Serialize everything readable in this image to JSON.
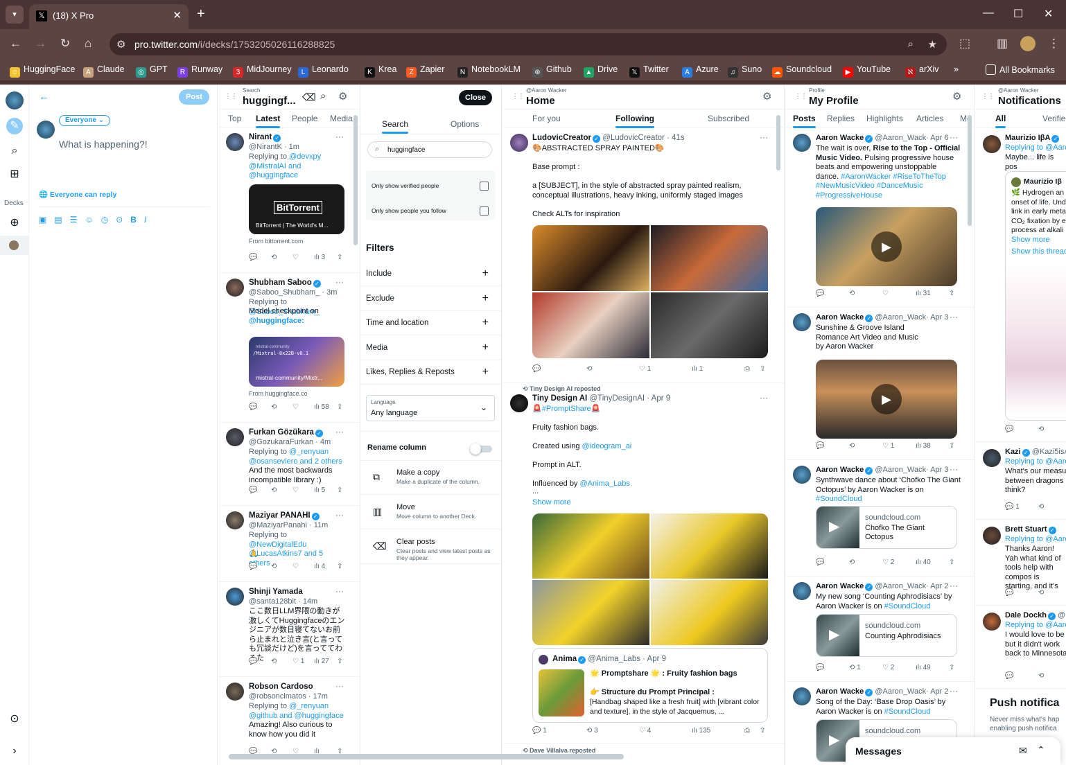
{
  "browser": {
    "tab_title": "(18) X Pro",
    "url_host": "pro.twitter.com",
    "url_path": "/i/decks/1753205026116288825",
    "bookmarks": [
      "HuggingFace",
      "Claude",
      "GPT",
      "Runway",
      "MidJourney",
      "Leonardo",
      "Krea",
      "Zapier",
      "NotebookLM",
      "Github",
      "Drive",
      "Twitter",
      "Azure",
      "Suno",
      "Soundcloud",
      "YouTube",
      "arXiv"
    ],
    "all_bookmarks": "All Bookmarks"
  },
  "sidebar": {
    "decks_label": "Decks"
  },
  "compose": {
    "post_label": "Post",
    "audience": "Everyone",
    "placeholder": "What is happening?!",
    "reply_setting": "Everyone can reply"
  },
  "search_col": {
    "small": "Search",
    "title": "huggingf...",
    "tabs": [
      "Top",
      "Latest",
      "People",
      "Media"
    ],
    "posts": [
      {
        "name": "Nirant",
        "handle": "@NirantK · 1m",
        "reply_prefix": "Replying to ",
        "reply": "@devxpy @MistralAI and @huggingface",
        "card_title": "BitTorrent",
        "card_caption": "BitTorrent | The World's M...",
        "from": "From bittorrent.com",
        "views": "3"
      },
      {
        "name": "Shubham Saboo",
        "handle": "@Saboo_Shubham_ · 3m",
        "reply_prefix": "Replying to ",
        "reply": "@Saboo_Shubham_",
        "text": "Model checkpoint on ",
        "mention": "@huggingface:",
        "card_small": "mistral-community",
        "card_code": "/Mixtral-8x22B-v0.1",
        "card_caption": "mistral-community/Mixtr...",
        "from": "From huggingface.co",
        "views": "58"
      },
      {
        "name": "Furkan Gözükara",
        "handle": "@GozukaraFurkan · 4m",
        "reply_prefix": "Replying to ",
        "reply": "@_renyuan @osanseviero and 2 others",
        "text": "And the most backwards incompatible library :)",
        "views": "5"
      },
      {
        "name": "Maziyar PANAHI",
        "handle": "@MaziyarPanahi · 11m",
        "reply_prefix": "Replying to ",
        "reply": "@NewDigitalEdu @LucasAtkins7 and 5 others",
        "text": "🙏",
        "views": "4"
      },
      {
        "name": "Shinji Yamada",
        "handle": "@santa128bit · 14m",
        "text": "ここ数日LLM界隈の動きが激しくてHuggingfaceのエンジニアが数日寝てないお前ら止まれと泣き言(と言っても冗談だけど)を言っててわろた",
        "likes": "1",
        "views": "27"
      },
      {
        "name": "Robson Cardoso",
        "handle": "@robsonclmatos · 17m",
        "reply_prefix": "Replying to ",
        "reply": "@_renyuan @github and @huggingface",
        "text": "Amazing! Also curious to know how you did it"
      }
    ]
  },
  "options_panel": {
    "close_label": "Close",
    "tab_search": "Search",
    "tab_options": "Options",
    "search_value": "huggingface",
    "verified_label": "Only show verified people",
    "follow_label": "Only show people you follow",
    "filters_title": "Filters",
    "filters": [
      "Include",
      "Exclude",
      "Time and location",
      "Media",
      "Likes, Replies & Reposts"
    ],
    "language_small": "Language",
    "language_value": "Any language",
    "rename_label": "Rename column",
    "actions": [
      {
        "title": "Make a copy",
        "desc": "Make a duplicate of the column."
      },
      {
        "title": "Move",
        "desc": "Move column to another Deck."
      },
      {
        "title": "Clear posts",
        "desc": "Clear posts and view latest posts as they appear."
      }
    ]
  },
  "home_col": {
    "small": "@Aaron Wacker",
    "title": "Home",
    "tabs": [
      "For you",
      "Following",
      "Subscribed"
    ],
    "post1": {
      "name": "LudovicCreator",
      "handle": "@LudovicCreator · 41s",
      "line1": "🎨ABSTRACTED SPRAY PAINTED🎨",
      "line2": "Base prompt :",
      "line3": "a [SUBJECT], in the style of abstracted spray painted realism, conceptual illustrations, heavy inking, uniformly staged images",
      "line4": "Check ALTs for inspiration",
      "likes": "1",
      "views": "1"
    },
    "post2": {
      "repost": "Tiny Design AI reposted",
      "name": "Tiny Design AI",
      "handle": "@TinyDesignAI · Apr 9",
      "tag": "🚨#PromptShare🚨",
      "l1": "Fruity fashion bags.",
      "l2": "Created using ",
      "l2m": "@ideogram_ai",
      "l3": "Prompt in ALT.",
      "l4": "Influenced by ",
      "l4m": "@Anima_Labs",
      "ellipsis": "...",
      "show_more": "Show more",
      "quote": {
        "name": "Anima",
        "handle": "@Anima_Labs · Apr 9",
        "q1": "🌟 Promptshare 🌟 : Fruity fashion bags",
        "q2": "👉 Structure du Prompt Principal :",
        "q3": "[Handbag shaped like a fresh fruit] with [vibrant color and texture], in the style of Jacquemus, ..."
      },
      "replies": "1",
      "reposts": "3",
      "likes": "4",
      "views": "135"
    },
    "post3": {
      "repost": "Dave Villalva reposted"
    }
  },
  "profile_col": {
    "small": "Profile",
    "title": "My Profile",
    "tabs": [
      "Posts",
      "Replies",
      "Highlights",
      "Articles",
      "Me"
    ],
    "posts": [
      {
        "name": "Aaron Wacke",
        "handle": "@Aaron_Wack· Apr 6",
        "t1": "The wait is over, ",
        "t1b": "Rise to the Top - Official Music Video.",
        "t2": " Pulsing progressive house beats and empowering unstoppable dance. ",
        "tags": "#AaronWacker #RiseToTheTop #NewMusicVideo #DanceMusic #ProgressiveHouse",
        "views": "31"
      },
      {
        "name": "Aaron Wacke",
        "handle": "@Aaron_Wack· Apr 3",
        "text": "Sunshine & Groove Island Romance Art Video and Music by Aaron Wacker",
        "likes": "1",
        "views": "38"
      },
      {
        "name": "Aaron Wacke",
        "handle": "@Aaron_Wack· Apr 3",
        "text": "Synthwave dance about ‘Chofko The Giant Octopus’ by Aaron Wacker is on ",
        "tag": "#SoundCloud",
        "site": "soundcloud.com",
        "card": "Chofko The Giant Octopus",
        "likes": "2",
        "views": "40"
      },
      {
        "name": "Aaron Wacke",
        "handle": "@Aaron_Wack· Apr 2",
        "text": "My new song ‘Counting Aphrodisiacs’ by Aaron Wacker is on ",
        "tag": "#SoundCloud",
        "site": "soundcloud.com",
        "card": "Counting Aphrodisiacs",
        "reposts": "1",
        "likes": "2",
        "views": "49"
      },
      {
        "name": "Aaron Wacke",
        "handle": "@Aaron_Wack· Apr 2",
        "text": "Song of the Day: ‘Base Drop Oasis’ by Aaron Wacker is on ",
        "tag": "#SoundCloud",
        "site": "soundcloud.com"
      }
    ]
  },
  "notif_col": {
    "small": "@Aaron Wacker",
    "title": "Notifications",
    "tabs": [
      "All",
      "Verifie"
    ],
    "items": [
      {
        "name": "Maurizio IβA",
        "handle": "",
        "reply": "Replying to @Aaron",
        "text": "Maybe... life is pos"
      },
      {
        "name": "Maurizio Iβ",
        "text": "🌿 Hydrogen an onset of life. Und link in early meta CO₂ fixation by e process at alkali",
        "show_more": "Show more",
        "thread": "Show this thread"
      },
      {
        "name": "Kazi",
        "handle": "@Kazi5isA",
        "reply": "Replying to @Aaro",
        "text": "What's our measu between dragons think?",
        "likes": "1"
      },
      {
        "name": "Brett Stuart",
        "reply": "Replying to @Aaro",
        "text": "Thanks Aaron! Yah what kind of tools help with compos is starting, and it's"
      },
      {
        "name": "Dale Dockh",
        "handle": "@Da",
        "reply": "Replying to @Aaro",
        "text": "I would love to be but it didn't work back to Minnesota"
      }
    ],
    "push_title": "Push notifica",
    "push_text": "Never miss what's hap enabling push notifica"
  },
  "messages": {
    "title": "Messages"
  }
}
